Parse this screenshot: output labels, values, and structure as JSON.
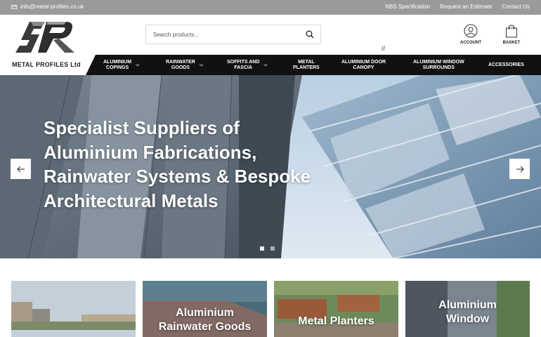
{
  "topbar": {
    "email": "info@metal-profiles.co.uk",
    "links": [
      "NBS Specification",
      "Request an Estimate",
      "Contact Us"
    ]
  },
  "header": {
    "logo_text": "METAL PROFILES Ltd",
    "search_placeholder": "Search products...",
    "account_label": "ACCOUNT",
    "basket_label": "BASKET",
    "slash_text": "//"
  },
  "nav": {
    "items": [
      {
        "label1": "ALUMINIUM",
        "label2": "COPINGS"
      },
      {
        "label1": "RAINWATER",
        "label2": "GOODS"
      },
      {
        "label1": "SOFFITS AND",
        "label2": "FASCIA"
      },
      {
        "label1": "METAL",
        "label2": "PLANTERS"
      },
      {
        "label1": "ALUMINIUM DOOR",
        "label2": "CANOPY"
      },
      {
        "label1": "ALUMINIUM WINDOW",
        "label2": "SURROUNDS"
      },
      {
        "label1": "ACCESSORIES",
        "label2": ""
      }
    ]
  },
  "hero": {
    "line1": "Specialist Suppliers of",
    "line2": "Aluminium Fabrications,",
    "line3": "Rainwater Systems & Bespoke",
    "line4": "Architectural Metals"
  },
  "cards": [
    {
      "line1": "",
      "line2": ""
    },
    {
      "line1": "Aluminium",
      "line2": "Rainwater Goods"
    },
    {
      "line1": "Metal Planters",
      "line2": ""
    },
    {
      "line1": "Aluminium",
      "line2": "Window"
    }
  ],
  "colors": {
    "topbar": "#9a9a9a",
    "nav": "#111111",
    "text": "#222222"
  }
}
